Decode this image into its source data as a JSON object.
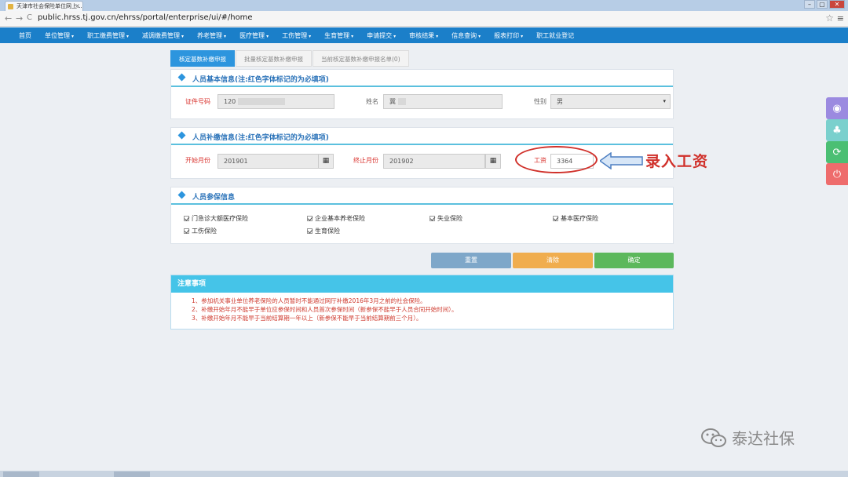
{
  "browser": {
    "tab_title": "天津市社会保险单位网上...",
    "tab_close": "×",
    "url": "public.hrss.tj.gov.cn/ehrss/portal/enterprise/ui/#/home",
    "back": "←",
    "forward": "→",
    "reload": "C",
    "star": "☆",
    "menu": "≡",
    "win_min": "–",
    "win_max": "▢",
    "win_close": "✕"
  },
  "nav": {
    "items": [
      {
        "label": "首页",
        "caret": false
      },
      {
        "label": "单位管理",
        "caret": true
      },
      {
        "label": "职工缴费管理",
        "caret": true
      },
      {
        "label": "减调缴费管理",
        "caret": true
      },
      {
        "label": "养老管理",
        "caret": true
      },
      {
        "label": "医疗管理",
        "caret": true
      },
      {
        "label": "工伤管理",
        "caret": true
      },
      {
        "label": "生育管理",
        "caret": true
      },
      {
        "label": "申请提交",
        "caret": true
      },
      {
        "label": "审核结果",
        "caret": true
      },
      {
        "label": "信息查询",
        "caret": true
      },
      {
        "label": "报表打印",
        "caret": true
      },
      {
        "label": "职工就业登记",
        "caret": false
      }
    ],
    "caret_glyph": "▾"
  },
  "page_tabs": [
    {
      "label": "核定基数补缴申报",
      "active": true
    },
    {
      "label": "批量核定基数补缴申报",
      "active": false
    },
    {
      "label": "当前核定基数补缴申报名单(0)",
      "active": false
    }
  ],
  "basic_info": {
    "title": "人员基本信息(注:红色字体标记的为必填项)",
    "id_label": "证件号码",
    "id_value": "120",
    "name_label": "姓名",
    "name_value": "冀",
    "gender_label": "性别",
    "gender_value": "男"
  },
  "supplement": {
    "title": "人员补缴信息(注:红色字体标记的为必填项)",
    "start_label": "开始月份",
    "start_value": "201901",
    "end_label": "终止月份",
    "end_value": "201902",
    "salary_label": "工资",
    "salary_value": "3364",
    "calendar_icon": "▦"
  },
  "insurance": {
    "title": "人员参保信息",
    "items": [
      "门急诊大额医疗保险",
      "企业基本养老保险",
      "失业保险",
      "基本医疗保险",
      "工伤保险",
      "生育保险"
    ]
  },
  "buttons": {
    "reset": "重置",
    "clear": "清除",
    "confirm": "确定"
  },
  "notice": {
    "title": "注意事项",
    "lines": [
      "1、参加机关事业单位养老保险的人员暂时不能通过网厅补缴2016年3月之前的社会保险。",
      "2、补缴开始年月不能早于单位应参保时间和人员首次参保时间（新参保不能早于人员合同开始时间）。",
      "3、补缴开始年月不能早于当前结算期一年以上（新参保不能早于当前结算期前三个月）。"
    ]
  },
  "annotation": {
    "text": "录入工资"
  },
  "side_tools": [
    {
      "icon": "eye-icon",
      "glyph": "◉",
      "color": "#9b8ae0"
    },
    {
      "icon": "tree-icon",
      "glyph": "♣",
      "color": "#7ad0cd"
    },
    {
      "icon": "refresh-icon",
      "glyph": "⟳",
      "color": "#4bbf73"
    },
    {
      "icon": "power-icon",
      "glyph": "⏻",
      "color": "#ee6c6c"
    }
  ],
  "watermark": {
    "text": "泰达社保"
  },
  "colors": {
    "nav_bg": "#1b7fc9",
    "tab_active": "#2d95de",
    "required_red": "#d9322d",
    "reset_btn": "#7ea7c9",
    "clear_btn": "#f0ad4e",
    "confirm_btn": "#5cb85c",
    "notice_head": "#45c4e8"
  }
}
